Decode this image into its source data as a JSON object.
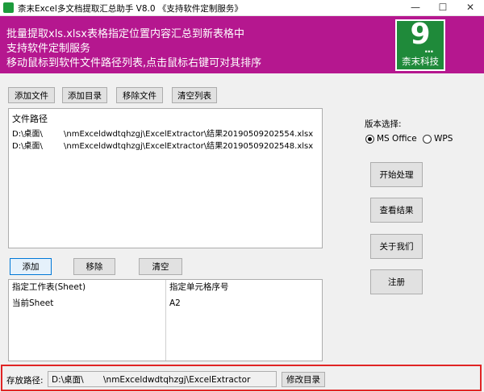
{
  "window": {
    "title": "柰末Excel多文档提取汇总助手 V8.0  《支持软件定制服务》",
    "minimize": "—",
    "maximize": "☐",
    "close": "✕"
  },
  "banner": {
    "line1": "批量提取xls.xlsx表格指定位置内容汇总到新表格中",
    "line2": "支持软件定制服务",
    "line3": "移动鼠标到软件文件路径列表,点击鼠标右键可对其排序",
    "logo_digit": "9",
    "logo_dots": "...",
    "logo_text": "柰末科技",
    "background": "#b5178f",
    "logo_green": "#1f8a3a"
  },
  "file_toolbar": {
    "add_file": "添加文件",
    "add_dir": "添加目录",
    "remove_file": "移除文件",
    "clear_list": "清空列表"
  },
  "file_list": {
    "header": "文件路径",
    "rows": [
      {
        "dir": "D:\\桌面\\",
        "path": "\\nmExceldwdtqhzgj\\ExcelExtractor\\结果20190509202554.xlsx"
      },
      {
        "dir": "D:\\桌面\\",
        "path": "\\nmExceldwdtqhzgj\\ExcelExtractor\\结果20190509202548.xlsx"
      }
    ]
  },
  "sheet_toolbar": {
    "add": "添加",
    "remove": "移除",
    "clear": "清空"
  },
  "sheet_grid": {
    "col1": "指定工作表(Sheet)",
    "col2": "指定单元格序号",
    "rows": [
      {
        "sheet": "当前Sheet",
        "cell": "A2"
      }
    ]
  },
  "version": {
    "label": "版本选择:",
    "ms_office": "MS Office",
    "wps": "WPS",
    "selected": "MS Office"
  },
  "actions": {
    "start": "开始处理",
    "view": "查看结果",
    "about": "关于我们",
    "register": "注册"
  },
  "save": {
    "label": "存放路径:",
    "path_dir": "D:\\桌面\\",
    "path_rest": "\\nmExceldwdtqhzgj\\ExcelExtractor",
    "change_dir": "修改目录"
  }
}
